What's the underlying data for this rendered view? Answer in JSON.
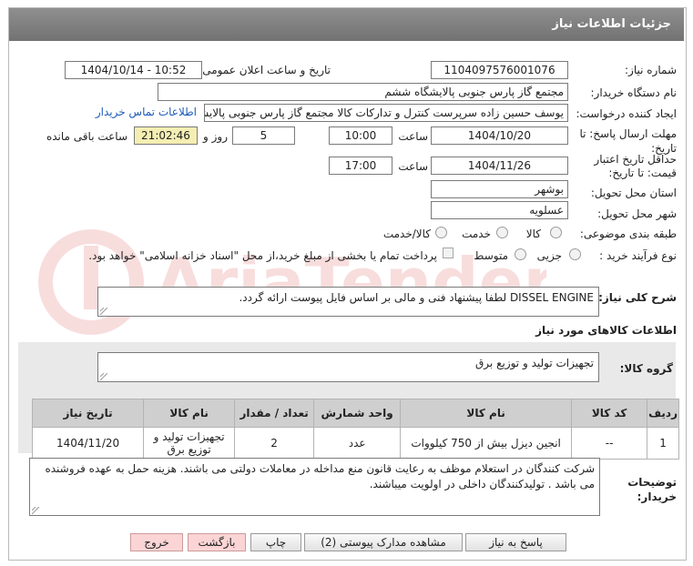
{
  "header": {
    "title": "جزئیات اطلاعات نیاز"
  },
  "fields": {
    "need_number_label": "شماره نیاز:",
    "need_number": "1104097576001076",
    "announce_label": "تاریخ و ساعت اعلان عمومی:",
    "announce_value": "1404/10/14 - 10:52",
    "buyer_label": "نام دستگاه خریدار:",
    "buyer": "مجتمع گاز پارس جنوبی  پالایشگاه ششم",
    "creator_label": "ایجاد کننده درخواست:",
    "creator": "یوسف حسین زاده سرپرست کنترل و تدارکات کالا مجتمع گاز پارس جنوبی  پالایشگاه ششم",
    "contact_link": "اطلاعات تماس خریدار",
    "deadline_label_1": "مهلت ارسال پاسخ: تا",
    "deadline_label_2": "تاریخ:",
    "deadline_date": "1404/10/20",
    "time_label": "ساعت",
    "deadline_time": "10:00",
    "days_value": "5",
    "days_label": "روز و",
    "remaining_time": "21:02:46",
    "remaining_label": "ساعت باقی مانده",
    "validity_label_1": "حداقل تاریخ اعتبار",
    "validity_label_2": "قیمت: تا تاریخ:",
    "validity_date": "1404/11/26",
    "validity_time": "17:00",
    "province_label": "استان محل تحویل:",
    "province": "بوشهر",
    "city_label": "شهر محل تحویل:",
    "city": "عسلویه",
    "category_label": "طبقه بندی موضوعی:",
    "category_options": [
      "کالا",
      "خدمت",
      "کالا/خدمت"
    ],
    "process_label": "نوع فرآیند خرید :",
    "process_options": [
      "جزیی",
      "متوسط"
    ],
    "process_note": "پرداخت تمام یا بخشی از مبلغ خرید،از محل \"اسناد خزانه اسلامی\" خواهد بود.",
    "description_label": "شرح کلی نیاز:",
    "description": "DISSEL ENGINE لطفا پیشنهاد فنی و مالی بر اساس فایل پیوست ارائه گردد.",
    "goods_section_title": "اطلاعات کالاهای مورد نیاز",
    "goods_group_label": "گروه کالا:",
    "goods_group": "تجهیزات تولید و توزیع برق"
  },
  "table": {
    "headers": [
      "ردیف",
      "کد کالا",
      "نام کالا",
      "واحد شمارش",
      "تعداد / مقدار",
      "نام کالا",
      "تاریخ نیاز"
    ],
    "rows": [
      {
        "row": "1",
        "code": "--",
        "name": "انجین دیزل بیش از 750 کیلووات",
        "unit": "عدد",
        "qty": "2",
        "group": "تجهیزات تولید و توزیع برق",
        "date": "1404/11/20"
      }
    ]
  },
  "buyer_notes": {
    "label_1": "توضیحات",
    "label_2": "خریدار:",
    "text": "شرکت کنندگان در استعلام موظف به رعایت قانون منع مداخله در معاملات دولتی می باشند. هزینه حمل به عهده فروشنده می باشد . تولیدکنندگان داخلی در اولویت میباشند."
  },
  "buttons": {
    "respond": "پاسخ به نیاز",
    "attachments": "مشاهده مدارک پیوستی (2)",
    "print": "چاپ",
    "back": "بازگشت",
    "exit": "خروج"
  }
}
